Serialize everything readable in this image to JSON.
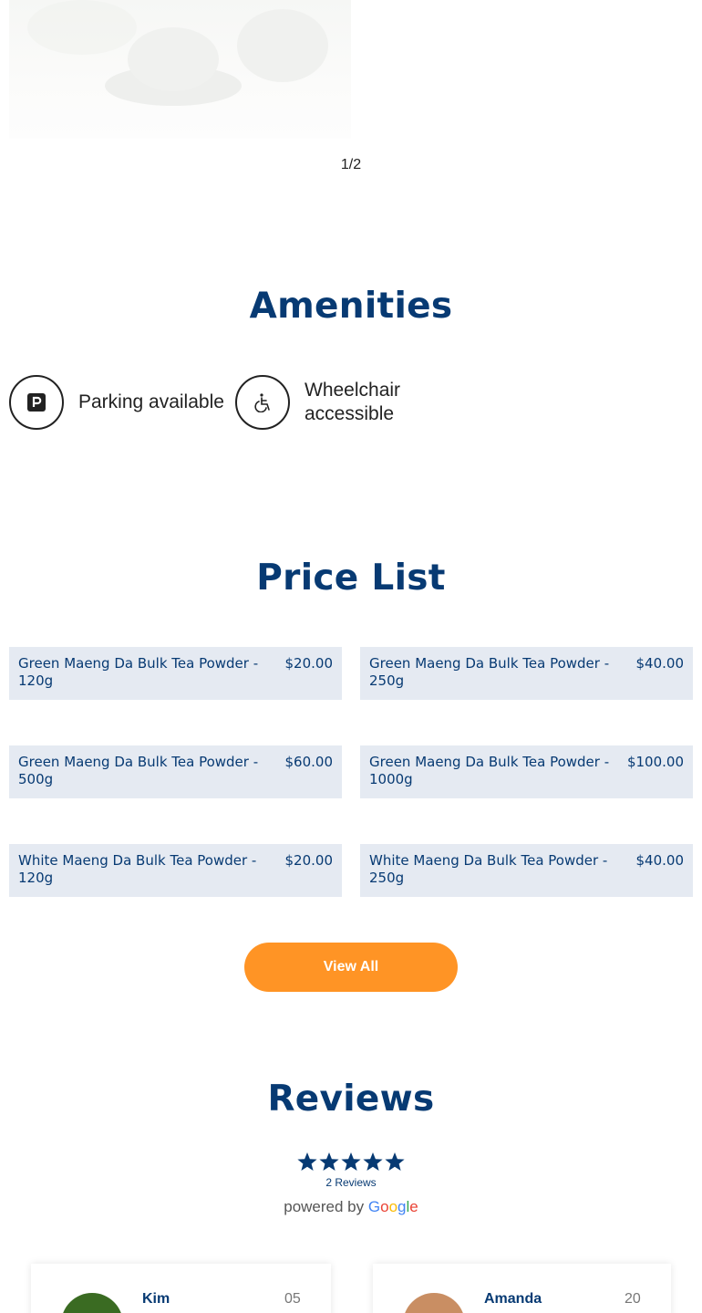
{
  "gallery": {
    "counter": "1/2"
  },
  "amenities": {
    "title": "Amenities",
    "items": [
      {
        "icon": "parking-icon",
        "label": "Parking available"
      },
      {
        "icon": "wheelchair-icon",
        "label": "Wheelchair accessible"
      }
    ]
  },
  "price_list": {
    "title": "Price List",
    "items": [
      {
        "name": "Green Maeng Da Bulk Tea Powder - 120g",
        "price": "$20.00"
      },
      {
        "name": "Green Maeng Da Bulk Tea Powder - 250g",
        "price": "$40.00"
      },
      {
        "name": "Green Maeng Da Bulk Tea Powder - 500g",
        "price": "$60.00"
      },
      {
        "name": "Green Maeng Da Bulk Tea Powder - 1000g",
        "price": "$100.00"
      },
      {
        "name": "White Maeng Da Bulk Tea Powder - 120g",
        "price": "$20.00"
      },
      {
        "name": "White Maeng Da Bulk Tea Powder - 250g",
        "price": "$40.00"
      }
    ],
    "view_all_label": "View All"
  },
  "reviews": {
    "title": "Reviews",
    "rating_stars": 5,
    "count_label": "2 Reviews",
    "powered_by": "powered by",
    "google_logo": "Google",
    "items": [
      {
        "name": "Kim",
        "date": "05",
        "avatar_color": "#3a6b22"
      },
      {
        "name": "Amanda",
        "date": "20",
        "avatar_color": "#c98e63"
      }
    ]
  },
  "colors": {
    "brand": "#073a73",
    "accent": "#ff9425",
    "card_bg": "#e5eaf2"
  }
}
